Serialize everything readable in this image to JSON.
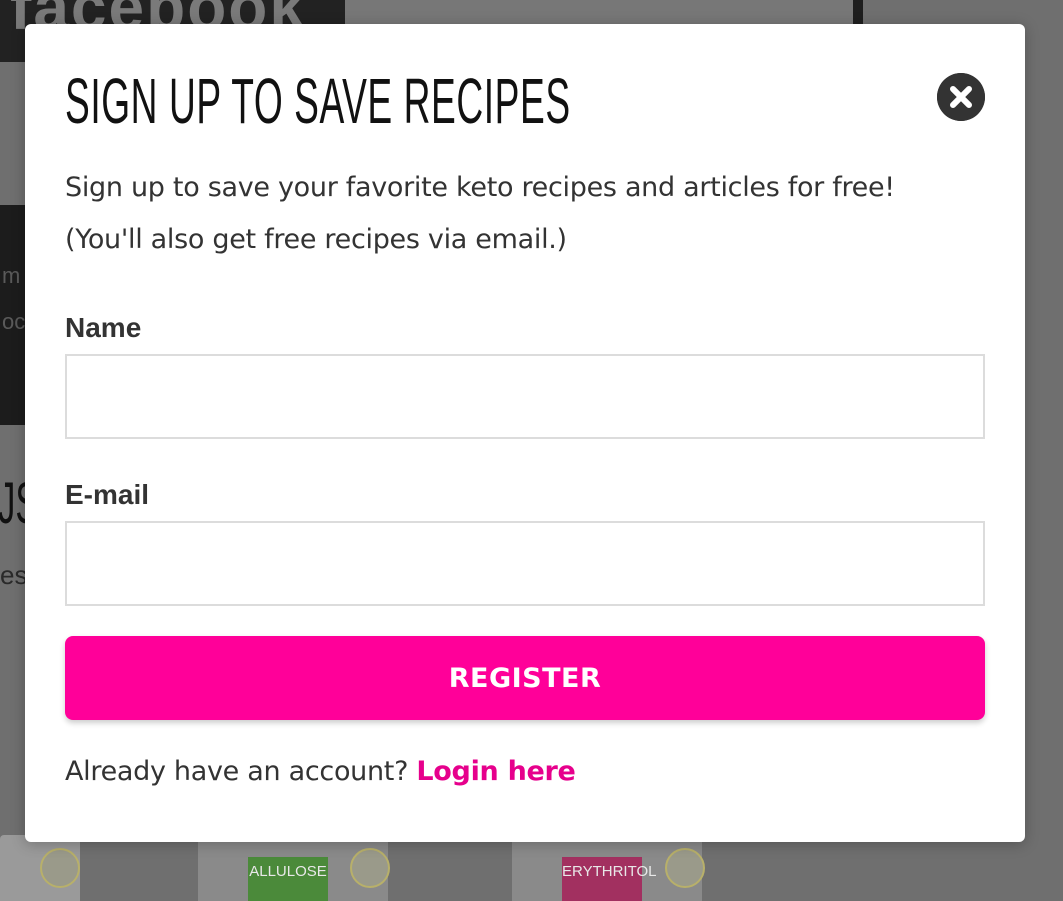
{
  "background": {
    "banner_text": "facebook",
    "panel_lines": [
      "m",
      "oc"
    ],
    "heading_fragment": "JS",
    "sub_fragment": "es",
    "products": [
      {
        "label": "ALLULOSE"
      },
      {
        "label": "ERYTHRITOL"
      }
    ]
  },
  "modal": {
    "title": "SIGN UP TO SAVE RECIPES",
    "description_line1": "Sign up to save your favorite keto recipes and articles for free!",
    "description_line2": "(You'll also get free recipes via email.)",
    "name_label": "Name",
    "name_value": "",
    "email_label": "E-mail",
    "email_value": "",
    "register_label": "REGISTER",
    "login_prompt": "Already have an account?",
    "login_link": "Login here",
    "close_icon": "close-circle-icon"
  },
  "colors": {
    "accent": "#ff0099",
    "link": "#e6008c",
    "text": "#333333",
    "overlay": "#6f6f6f"
  }
}
